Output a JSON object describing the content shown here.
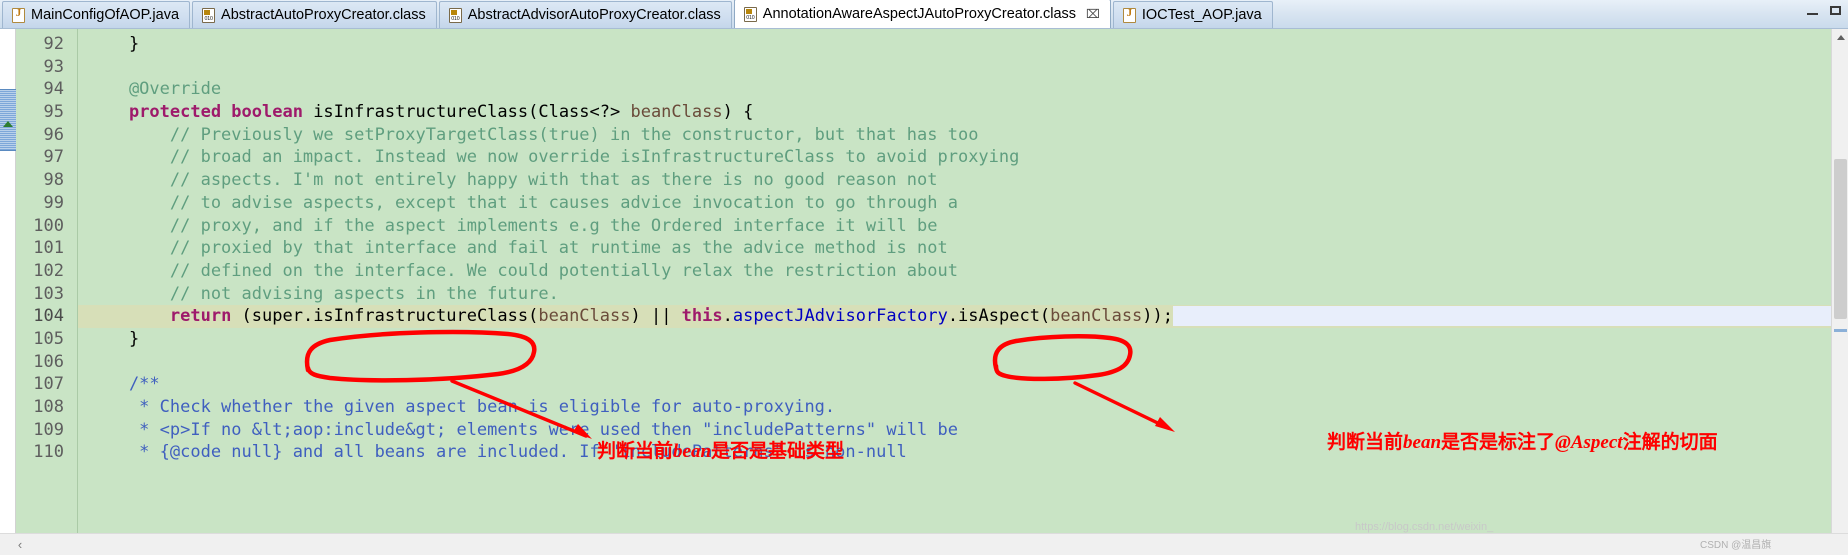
{
  "window": {
    "minimize_label": "–",
    "maximize_label": "□"
  },
  "tabs": [
    {
      "label": "MainConfigOfAOP.java",
      "icon": "java-file-icon",
      "active": false,
      "closable": false
    },
    {
      "label": "AbstractAutoProxyCreator.class",
      "icon": "class-file-icon",
      "active": false,
      "closable": false
    },
    {
      "label": "AbstractAdvisorAutoProxyCreator.class",
      "icon": "class-file-icon",
      "active": false,
      "closable": false
    },
    {
      "label": "AnnotationAwareAspectJAutoProxyCreator.class",
      "icon": "class-file-icon",
      "active": true,
      "closable": true,
      "close_glyph": "⌧"
    },
    {
      "label": "IOCTest_AOP.java",
      "icon": "java-file-icon",
      "active": false,
      "closable": false
    }
  ],
  "editor": {
    "first_line": 92,
    "current_line": 104,
    "lines": [
      {
        "no": "92",
        "fold": false,
        "current": false,
        "tokens": [
          {
            "t": "plain",
            "s": "    }"
          }
        ]
      },
      {
        "no": "93",
        "fold": false,
        "current": false,
        "tokens": [
          {
            "t": "plain",
            "s": ""
          }
        ]
      },
      {
        "no": "94",
        "fold": true,
        "current": false,
        "tokens": [
          {
            "t": "cmt",
            "s": "    @Override"
          }
        ]
      },
      {
        "no": "95",
        "fold": false,
        "current": false,
        "tokens": [
          {
            "t": "plain",
            "s": "    "
          },
          {
            "t": "kw",
            "s": "protected boolean"
          },
          {
            "t": "plain",
            "s": " isInfrastructureClass(Class<?> "
          },
          {
            "t": "param",
            "s": "beanClass"
          },
          {
            "t": "plain",
            "s": ") {"
          }
        ]
      },
      {
        "no": "96",
        "fold": false,
        "current": false,
        "tokens": [
          {
            "t": "cmt",
            "s": "        // Previously we setProxyTargetClass(true) in the constructor, but that has too"
          }
        ]
      },
      {
        "no": "97",
        "fold": false,
        "current": false,
        "tokens": [
          {
            "t": "cmt",
            "s": "        // broad an impact. Instead we now override isInfrastructureClass to avoid proxying"
          }
        ]
      },
      {
        "no": "98",
        "fold": false,
        "current": false,
        "tokens": [
          {
            "t": "cmt",
            "s": "        // aspects. I'm not entirely happy with that as there is no good reason not"
          }
        ]
      },
      {
        "no": "99",
        "fold": false,
        "current": false,
        "tokens": [
          {
            "t": "cmt",
            "s": "        // to advise aspects, except that it causes advice invocation to go through a"
          }
        ]
      },
      {
        "no": "100",
        "fold": false,
        "current": false,
        "tokens": [
          {
            "t": "cmt",
            "s": "        // proxy, and if the aspect implements e.g the Ordered interface it will be"
          }
        ]
      },
      {
        "no": "101",
        "fold": false,
        "current": false,
        "tokens": [
          {
            "t": "cmt",
            "s": "        // proxied by that interface and fail at runtime as the advice method is not"
          }
        ]
      },
      {
        "no": "102",
        "fold": false,
        "current": false,
        "tokens": [
          {
            "t": "cmt",
            "s": "        // defined on the interface. We could potentially relax the restriction about"
          }
        ]
      },
      {
        "no": "103",
        "fold": false,
        "current": false,
        "tokens": [
          {
            "t": "cmt",
            "s": "        // not advising aspects in the future."
          }
        ]
      },
      {
        "no": "104",
        "fold": false,
        "current": true,
        "tokens": [
          {
            "t": "plain",
            "s": "        "
          },
          {
            "t": "kw",
            "s": "return"
          },
          {
            "t": "plain",
            "s": " (super.isInfrastructureClass("
          },
          {
            "t": "param",
            "s": "beanClass"
          },
          {
            "t": "plain",
            "s": ") || "
          },
          {
            "t": "kw",
            "s": "this"
          },
          {
            "t": "plain",
            "s": "."
          },
          {
            "t": "field",
            "s": "aspectJAdvisorFactory"
          },
          {
            "t": "plain",
            "s": ".isAspect("
          },
          {
            "t": "param",
            "s": "beanClass"
          },
          {
            "t": "plain",
            "s": "));"
          }
        ]
      },
      {
        "no": "105",
        "fold": false,
        "current": false,
        "tokens": [
          {
            "t": "plain",
            "s": "    }"
          }
        ]
      },
      {
        "no": "106",
        "fold": false,
        "current": false,
        "tokens": [
          {
            "t": "plain",
            "s": ""
          }
        ]
      },
      {
        "no": "107",
        "fold": true,
        "current": false,
        "tokens": [
          {
            "t": "jdoc",
            "s": "    /**"
          }
        ]
      },
      {
        "no": "108",
        "fold": false,
        "current": false,
        "tokens": [
          {
            "t": "jdoc",
            "s": "     * Check whether the given aspect bean is eligible for auto-proxying."
          }
        ]
      },
      {
        "no": "109",
        "fold": false,
        "current": false,
        "tokens": [
          {
            "t": "jdoc",
            "s": "     * <p>If no &lt;aop:include&gt; elements were used then \"includePatterns\" will be"
          }
        ]
      },
      {
        "no": "110",
        "fold": false,
        "current": false,
        "tokens": [
          {
            "t": "jdoc",
            "s": "     * {@code null} and all beans are included. If \"includePatterns\" is non-null"
          }
        ]
      }
    ]
  },
  "annotations": [
    {
      "name": "note-infrastructure-class",
      "text_parts": [
        {
          "s": "判断当前",
          "style": "zh"
        },
        {
          "s": "bean",
          "style": "lat"
        },
        {
          "s": "是否是基础类型",
          "style": "zh"
        }
      ],
      "full_text": "判断当前bean是否是基础类型"
    },
    {
      "name": "note-is-aspect",
      "text_parts": [
        {
          "s": "判断当前",
          "style": "zh"
        },
        {
          "s": "bean",
          "style": "lat"
        },
        {
          "s": "是否是标注了",
          "style": "zh"
        },
        {
          "s": "@Aspect",
          "style": "lat"
        },
        {
          "s": "注解的切面",
          "style": "zh"
        }
      ],
      "full_text": "判断当前bean是否是标注了@Aspect注解的切面"
    }
  ],
  "ink": {
    "color": "#ff0000",
    "ellipses": [
      {
        "name": "circle-isInfrastructureClass",
        "label": "isInfrastructureClass"
      },
      {
        "name": "circle-isAspect",
        "label": "isAspect"
      }
    ]
  },
  "watermarks": {
    "blog_url": "https://blog.csdn.net/weixin_",
    "csdn": "CSDN @温昌旗"
  },
  "scrollbars": {
    "horizontal_left_glyph": "‹",
    "vertical_up_glyph": "▲",
    "vertical_down_glyph": "▼"
  },
  "colors": {
    "code_background": "#c9e4c5",
    "current_line": "#d7dfb8",
    "keyword": "#9e1a6b",
    "comment": "#5f9e7f",
    "javadoc": "#3f5fbf",
    "field": "#0000c0",
    "annotation_red": "#ff0000"
  }
}
